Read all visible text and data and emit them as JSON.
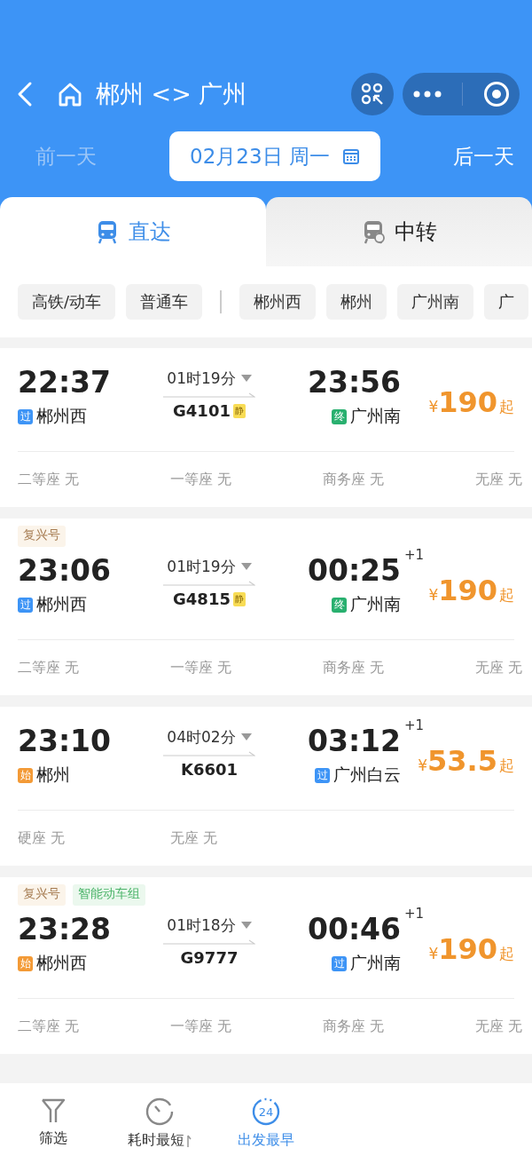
{
  "header": {
    "title": "郴州 <> 广州"
  },
  "date_bar": {
    "prev": {
      "label": "前一天",
      "disabled": true
    },
    "date": "02月23日 周一",
    "next": {
      "label": "后一天",
      "disabled": false
    }
  },
  "tabs": [
    {
      "label": "直达",
      "selected": true
    },
    {
      "label": "中转",
      "selected": false
    }
  ],
  "filters": {
    "train_types": [
      "高铁/动车",
      "普通车"
    ],
    "stations": [
      "郴州西",
      "郴州",
      "广州南",
      "广"
    ]
  },
  "trains": [
    {
      "depart_time": "22:37",
      "depart_station": {
        "mark": "过",
        "kind": "pass",
        "name": "郴州西"
      },
      "duration": "01时19分",
      "number": "G4101",
      "quiet_badge": "静",
      "arrive_time": "23:56",
      "arrive_station": {
        "mark": "终",
        "kind": "end",
        "name": "广州南"
      },
      "price_symbol": "¥",
      "price": "190",
      "price_suffix": "起",
      "seats": [
        "二等座 无",
        "一等座 无",
        "商务座 无",
        "无座 无"
      ]
    },
    {
      "tags": [
        {
          "label": "复兴号",
          "kind": "brand"
        }
      ],
      "depart_time": "23:06",
      "depart_station": {
        "mark": "过",
        "kind": "pass",
        "name": "郴州西"
      },
      "duration": "01时19分",
      "number": "G4815",
      "quiet_badge": "静",
      "arrive_time": "00:25",
      "next_day": "+1",
      "arrive_station": {
        "mark": "终",
        "kind": "end",
        "name": "广州南"
      },
      "price_symbol": "¥",
      "price": "190",
      "price_suffix": "起",
      "seats": [
        "二等座 无",
        "一等座 无",
        "商务座 无",
        "无座 无"
      ]
    },
    {
      "depart_time": "23:10",
      "depart_station": {
        "mark": "始",
        "kind": "start",
        "name": "郴州"
      },
      "duration": "04时02分",
      "number": "K6601",
      "arrive_time": "03:12",
      "next_day": "+1",
      "arrive_station": {
        "mark": "过",
        "kind": "pass",
        "name": "广州白云"
      },
      "price_symbol": "¥",
      "price": "53.5",
      "price_suffix": "起",
      "seats": [
        "硬座 无",
        "无座 无"
      ]
    },
    {
      "tags": [
        {
          "label": "复兴号",
          "kind": "brand"
        },
        {
          "label": "智能动车组",
          "kind": "smart"
        }
      ],
      "depart_time": "23:28",
      "depart_station": {
        "mark": "始",
        "kind": "start",
        "name": "郴州西"
      },
      "duration": "01时18分",
      "number": "G9777",
      "arrive_time": "00:46",
      "next_day": "+1",
      "arrive_station": {
        "mark": "过",
        "kind": "pass",
        "name": "广州南"
      },
      "price_symbol": "¥",
      "price": "190",
      "price_suffix": "起",
      "seats": [
        "二等座 无",
        "一等座 无",
        "商务座 无",
        "无座 无"
      ]
    }
  ],
  "bottom_nav": [
    {
      "label": "筛选",
      "kind": "filter",
      "selected": false
    },
    {
      "label": "耗时最短",
      "kind": "timer",
      "selected": false
    },
    {
      "label": "出发最早",
      "kind": "clock24",
      "icon_text": "24",
      "selected": true
    }
  ]
}
